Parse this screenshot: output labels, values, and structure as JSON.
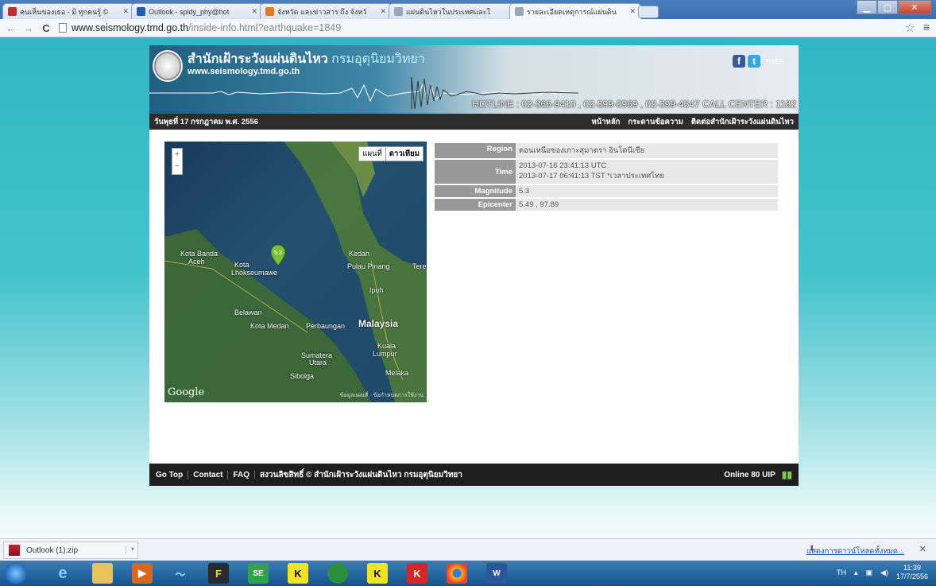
{
  "browser": {
    "tabs": [
      {
        "title": "คนเห็นของเธอ - มิ ทุกคนรู้ ©",
        "active": false,
        "favicon_color": "#c0302b"
      },
      {
        "title": "Outlook - spidy_phy@hot",
        "active": false,
        "favicon_color": "#1f5fb4"
      },
      {
        "title": "จังหวัด และข่าวสาร ถึง จังหวั",
        "active": false,
        "favicon_color": "#e07b22"
      },
      {
        "title": "แผ่นดินไหวในประเทศและใ",
        "active": false,
        "favicon_color": "#9aa7b7"
      },
      {
        "title": "รายละเอียดเหตุการณ์แผ่นดิน",
        "active": true,
        "favicon_color": "#9aa7b7"
      }
    ],
    "url_host": "www.seismology.tmd.go.th",
    "url_path": "/inside-info.html?earthquake=1849"
  },
  "site": {
    "title": "สำนักเฝ้าระวังแผ่นดินไหว",
    "dept": "กรมอุตุนิยมวิทยา",
    "url": "www.seismology.tmd.go.th",
    "hotline": "HOTLINE : 02-366-9410 , 02-399-0969 , 02-399-4547 CALL CENTER : 1182",
    "lang": "TH/EN",
    "date": "วันพุธที่ 17 กรกฎาคม พ.ศ. 2556",
    "nav": [
      "หน้าหลัก",
      "กระดานข้อความ",
      "ติดต่อสำนักเฝ้าระวังแผ่นดินไหว"
    ]
  },
  "map": {
    "type_buttons": [
      "แผนที่",
      "ดาวเทียม"
    ],
    "marker_label": "5.3",
    "labels": [
      {
        "text": "Kota Banda"
      },
      {
        "text": "Aceh"
      },
      {
        "text": "Kota"
      },
      {
        "text": "Lhokseumawe"
      },
      {
        "text": "Belawan"
      },
      {
        "text": "Kota Medan"
      },
      {
        "text": "Perbaungan"
      },
      {
        "text": "Malaysia"
      },
      {
        "text": "Ipoh"
      },
      {
        "text": "Kuala"
      },
      {
        "text": "Lumpur"
      },
      {
        "text": "Melaka"
      },
      {
        "text": "Kedah"
      },
      {
        "text": "Pulau Pinang"
      },
      {
        "text": "Tere"
      },
      {
        "text": "Sumatera"
      },
      {
        "text": "Utara"
      },
      {
        "text": "Sibolga"
      }
    ],
    "logo": "Google",
    "terms": "ข้อมูลแผนที่ · ข้อกำหนดการใช้งาน"
  },
  "details": [
    {
      "label": "Region",
      "value": "ตอนเหนือของเกาะสุมาตรา อินโดนีเซีย"
    },
    {
      "label": "Time",
      "value": "2013-07-16 23:41:13 UTC",
      "value2": "2013-07-17 06:41:13 TST *เวลาประเทศไทย"
    },
    {
      "label": "Magnitude",
      "value": "5.3"
    },
    {
      "label": "Epicenter",
      "value": "5.49 , 97.89"
    }
  ],
  "footer": {
    "links": [
      "Go Top",
      "Contact",
      "FAQ"
    ],
    "copyright": "สงวนลิขสิทธิ์ © สำนักเฝ้าระวังแผ่นดินไหว กรมอุตุนิยมวิทยา",
    "online_label": "Online",
    "online_count": "80",
    "online_unit": "UIP"
  },
  "downloads": {
    "file": "Outlook (1).zip",
    "show_all": "แสดงการดาวน์โหลดทั้งหมด..."
  },
  "taskbar": {
    "lang": "TH",
    "time": "11:39",
    "date": "17/7/2556"
  },
  "colors": {
    "page_bg": "#2fb8c3",
    "bar": "#2d2d2d",
    "label_bg": "#999999",
    "value_bg": "#e8e8e8",
    "marker": "#7cbf3a"
  }
}
